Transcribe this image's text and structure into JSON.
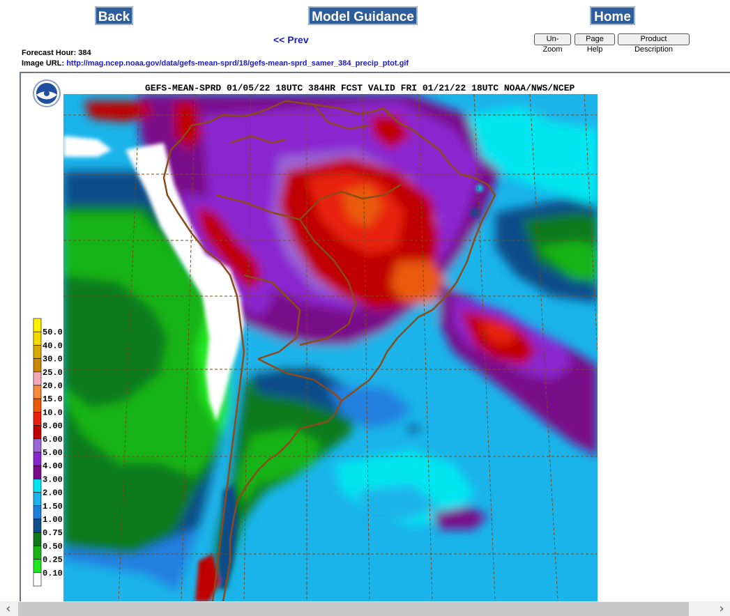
{
  "nav": {
    "back": "Back",
    "model_guidance": "Model Guidance",
    "home": "Home",
    "prev": "<< Prev"
  },
  "toolbar": {
    "unzoom": "Un-Zoom",
    "page_help": "Page Help",
    "product_description": "Product Description"
  },
  "info": {
    "forecast_hour_label": "Forecast Hour: 384",
    "image_url_label": "Image URL:",
    "image_url": "http://mag.ncep.noaa.gov/data/gefs-mean-sprd/18/gefs-mean-sprd_samer_384_precip_ptot.gif"
  },
  "map": {
    "header": "GEFS-MEAN-SPRD 01/05/22 18UTC 384HR FCST VALID FRI 01/21/22 18UTC NOAA/NWS/NCEP",
    "legend": [
      {
        "label": "50.0",
        "color": "#fff200"
      },
      {
        "label": "40.0",
        "color": "#f4d800"
      },
      {
        "label": "30.0",
        "color": "#d8a800"
      },
      {
        "label": "25.0",
        "color": "#c88a00"
      },
      {
        "label": "20.0",
        "color": "#f4a8b8"
      },
      {
        "label": "15.0",
        "color": "#f78b3c"
      },
      {
        "label": "10.0",
        "color": "#ea5a0a"
      },
      {
        "label": "8.00",
        "color": "#e8200c"
      },
      {
        "label": "6.00",
        "color": "#c00000"
      },
      {
        "label": "5.00",
        "color": "#9a66d8"
      },
      {
        "label": "4.00",
        "color": "#8a28d0"
      },
      {
        "label": "3.00",
        "color": "#7a0a8a"
      },
      {
        "label": "2.00",
        "color": "#00e6f0"
      },
      {
        "label": "1.50",
        "color": "#1ab4ea"
      },
      {
        "label": "1.00",
        "color": "#2080e0"
      },
      {
        "label": "0.75",
        "color": "#104e8a"
      },
      {
        "label": "0.50",
        "color": "#0e7a1a"
      },
      {
        "label": "0.25",
        "color": "#18b418"
      },
      {
        "label": "0.10",
        "color": "#22e622"
      },
      {
        "label": "",
        "color": "#ffffff"
      }
    ]
  }
}
